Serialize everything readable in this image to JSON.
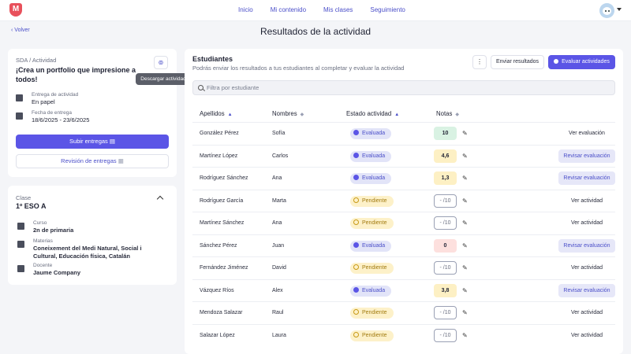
{
  "nav": {
    "logo": "M",
    "items": [
      {
        "label": "Inicio"
      },
      {
        "label": "Mi contenido"
      },
      {
        "label": "Mis clases"
      },
      {
        "label": "Seguimiento"
      }
    ]
  },
  "header": {
    "back": "Volver",
    "title": "Resultados de la actividad"
  },
  "activity": {
    "label": "SDA / Actividad",
    "title": "¡Crea un portfolio que impresione a todos!",
    "tooltip": "Descargar actividad",
    "delivery_label": "Entrega de actividad",
    "delivery_value": "En papel",
    "date_label": "Fecha de entrega",
    "date_value": "18/6/2025 - 23/6/2025",
    "submit_button": "Subir entregas",
    "review_button": "Revisión de entregas"
  },
  "class": {
    "label": "Clase",
    "name": "1º ESO A",
    "course_label": "Curso",
    "course_value": "2n de primaria",
    "subjects_label": "Materias",
    "subjects_value": "Coneixement del Medi Natural, Social i Cultural, Educación física, Catalán",
    "teacher_label": "Docente",
    "teacher_value": "Jaume Company"
  },
  "students": {
    "title": "Estudiantes",
    "subtitle": "Podrás enviar los resultados a tus estudiantes al completar y evaluar la actividad",
    "more_button": "⋮",
    "send_button": "Enviar resultados",
    "evaluate_button": "Evaluar actividades",
    "filter_placeholder": "Filtra por estudiante",
    "columns": [
      "Apellidos",
      "Nombres",
      "Estado actividad",
      "Notas"
    ],
    "rows": [
      {
        "surname": "González Pérez",
        "name": "Sofía",
        "status": "Evaluada",
        "status_type": "eval",
        "grade": "10",
        "grade_type": "green",
        "action": "Ver evaluación",
        "action_type": "ver"
      },
      {
        "surname": "Martínez López",
        "name": "Carlos",
        "status": "Evaluada",
        "status_type": "eval",
        "grade": "4,6",
        "grade_type": "yellow",
        "action": "Revisar evaluación",
        "action_type": "revisar"
      },
      {
        "surname": "Rodríguez Sánchez",
        "name": "Ana",
        "status": "Evaluada",
        "status_type": "eval",
        "grade": "1,3",
        "grade_type": "yellow",
        "action": "Revisar evaluación",
        "action_type": "revisar"
      },
      {
        "surname": "Rodríguez García",
        "name": "Marta",
        "status": "Pendiente",
        "status_type": "pend",
        "grade": "- /10",
        "grade_type": "empty",
        "action": "Ver actividad",
        "action_type": "ver"
      },
      {
        "surname": "Martínez Sánchez",
        "name": "Ana",
        "status": "Pendiente",
        "status_type": "pend",
        "grade": "- /10",
        "grade_type": "empty",
        "action": "Ver actividad",
        "action_type": "ver"
      },
      {
        "surname": "Sánchez Pérez",
        "name": "Juan",
        "status": "Evaluada",
        "status_type": "eval",
        "grade": "0",
        "grade_type": "red",
        "action": "Revisar evaluación",
        "action_type": "revisar"
      },
      {
        "surname": "Fernández Jiménez",
        "name": "David",
        "status": "Pendiente",
        "status_type": "pend",
        "grade": "- /10",
        "grade_type": "empty",
        "action": "Ver actividad",
        "action_type": "ver"
      },
      {
        "surname": "Vázquez Ríos",
        "name": "Alex",
        "status": "Evaluada",
        "status_type": "eval",
        "grade": "3,8",
        "grade_type": "yellow",
        "action": "Revisar evaluación",
        "action_type": "revisar"
      },
      {
        "surname": "Mendoza Salazar",
        "name": "Raul",
        "status": "Pendiente",
        "status_type": "pend",
        "grade": "- /10",
        "grade_type": "empty",
        "action": "Ver actividad",
        "action_type": "ver"
      },
      {
        "surname": "Salazar López",
        "name": "Laura",
        "status": "Pendiente",
        "status_type": "pend",
        "grade": "- /10",
        "grade_type": "empty",
        "action": "Ver actividad",
        "action_type": "ver"
      }
    ]
  },
  "colors": {
    "primary": "#5b55e6",
    "link": "#4b4fc9",
    "logo": "#e8505b",
    "pending": "#fdf1c9",
    "evaluated": "#e2e4f8"
  }
}
